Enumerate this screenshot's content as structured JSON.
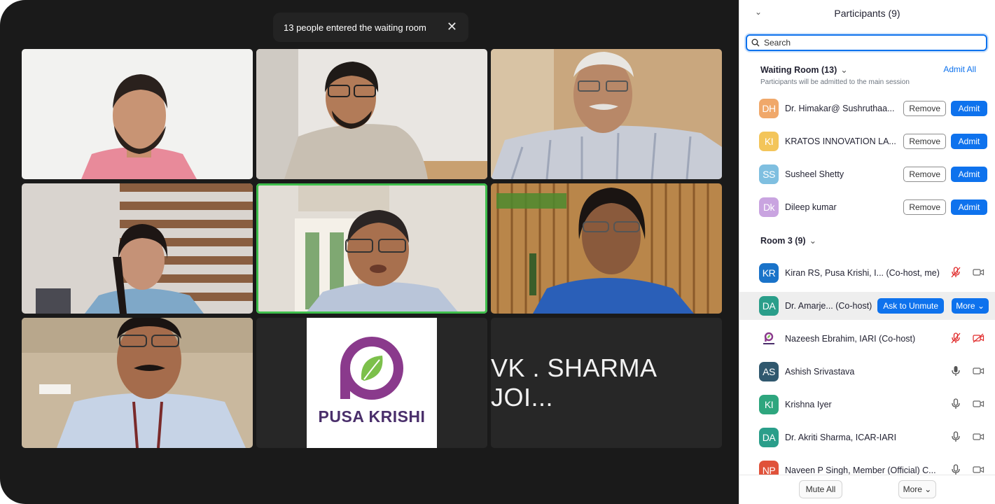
{
  "toast": {
    "message": "13 people entered the waiting room",
    "close_glyph": "✕"
  },
  "tiles": {
    "vk_sharma_text": "VK . SHARMA JOI...",
    "logo_text": "PUSA KRISHI"
  },
  "panel": {
    "collapse_glyph": "⌄",
    "title": "Participants (9)",
    "search_placeholder": "Search",
    "waiting_room": {
      "title": "Waiting Room (13)",
      "chevron": "⌄",
      "admit_all": "Admit All",
      "subtitle": "Participants will be admitted to the main session",
      "remove_label": "Remove",
      "admit_label": "Admit",
      "people": [
        {
          "initials": "DH",
          "name": "Dr. Himakar@ Sushruthaa...",
          "color": "#f0a86a"
        },
        {
          "initials": "KI",
          "name": "KRATOS INNOVATION LA...",
          "color": "#f3c55a"
        },
        {
          "initials": "SS",
          "name": "Susheel Shetty",
          "color": "#7fbfe0"
        },
        {
          "initials": "Dk",
          "name": "Dileep kumar",
          "color": "#c9a4e0"
        }
      ]
    },
    "room": {
      "title": "Room 3 (9)",
      "chevron": "⌄",
      "people": [
        {
          "initials": "KR",
          "name": "Kiran RS, Pusa Krishi, I...  (Co-host, me)",
          "color": "#1a73c9",
          "mic": "muted",
          "cam": "on"
        },
        {
          "initials": "DA",
          "name": "Dr. Amarje... (Co-host)",
          "color": "#2a9e8a",
          "ask_label": "Ask to Unmute",
          "more_label": "More ⌄"
        },
        {
          "initials": "",
          "name": "Nazeesh Ebrahim, IARI (Co-host)",
          "color": "#ffffff",
          "mic": "muted",
          "cam": "off"
        },
        {
          "initials": "AS",
          "name": "Ashish Srivastava",
          "color": "#30586e",
          "mic": "on",
          "cam": "on"
        },
        {
          "initials": "KI",
          "name": "Krishna Iyer",
          "color": "#2ea67e",
          "mic": "on",
          "cam": "on"
        },
        {
          "initials": "DA",
          "name": "Dr. Akriti Sharma, ICAR-IARI",
          "color": "#2a9e8a",
          "mic": "on",
          "cam": "on"
        },
        {
          "initials": "NP",
          "name": "Naveen P Singh, Member (Official) C...",
          "color": "#e0523a",
          "mic": "on",
          "cam": "on"
        }
      ]
    },
    "footer": {
      "mute_all": "Mute All",
      "more": "More ⌄"
    }
  },
  "colors": {
    "accent": "#0e72ed",
    "speaking_border": "#3fbe4c",
    "muted_icon": "#e02828",
    "logo_purple": "#8a3a8c",
    "logo_green": "#7cc04b"
  }
}
